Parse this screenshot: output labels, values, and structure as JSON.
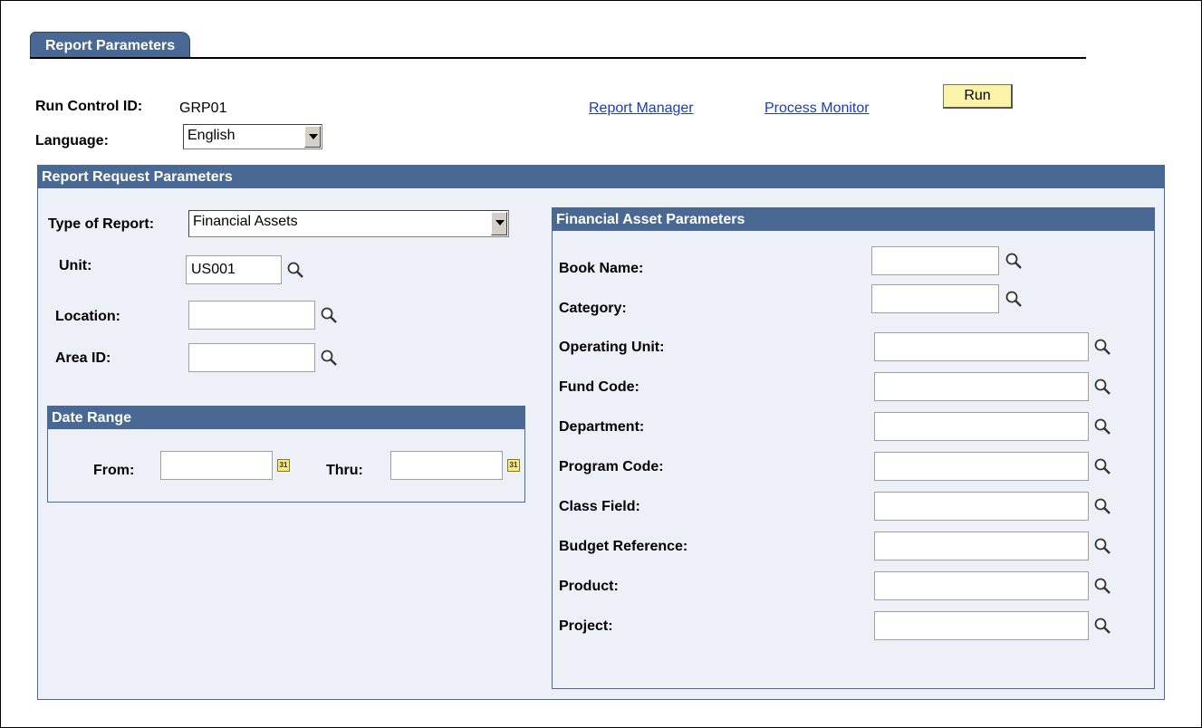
{
  "tab": {
    "label": "Report Parameters"
  },
  "header": {
    "run_control_label": "Run Control ID:",
    "run_control_value": "GRP01",
    "language_label": "Language:",
    "language_value": "English",
    "report_manager": "Report Manager",
    "process_monitor": "Process Monitor",
    "run_label": "Run"
  },
  "request": {
    "title": "Report Request Parameters",
    "type_label": "Type of Report:",
    "type_value": "Financial Assets",
    "unit_label": "Unit:",
    "unit_value": "US001",
    "location_label": "Location:",
    "location_value": "",
    "area_label": "Area ID:",
    "area_value": ""
  },
  "date_range": {
    "title": "Date Range",
    "from_label": "From:",
    "from_value": "",
    "thru_label": "Thru:",
    "thru_value": "",
    "cal_glyph": "31"
  },
  "fa": {
    "title": "Financial Asset Parameters",
    "fields": [
      {
        "label": "Book Name:",
        "value": ""
      },
      {
        "label": "Category:",
        "value": ""
      },
      {
        "label": "Operating Unit:",
        "value": ""
      },
      {
        "label": "Fund Code:",
        "value": ""
      },
      {
        "label": "Department:",
        "value": ""
      },
      {
        "label": "Program Code:",
        "value": ""
      },
      {
        "label": "Class Field:",
        "value": ""
      },
      {
        "label": "Budget Reference:",
        "value": ""
      },
      {
        "label": "Product:",
        "value": ""
      },
      {
        "label": "Project:",
        "value": ""
      }
    ]
  },
  "colors": {
    "header_blue": "#4a6894",
    "panel_bg": "#eef0f8",
    "run_button": "#fbf4a8",
    "link": "#1a3cb8"
  },
  "icons": {
    "lookup": "magnifier-icon",
    "calendar": "calendar-icon",
    "dropdown": "chevron-down-icon"
  }
}
